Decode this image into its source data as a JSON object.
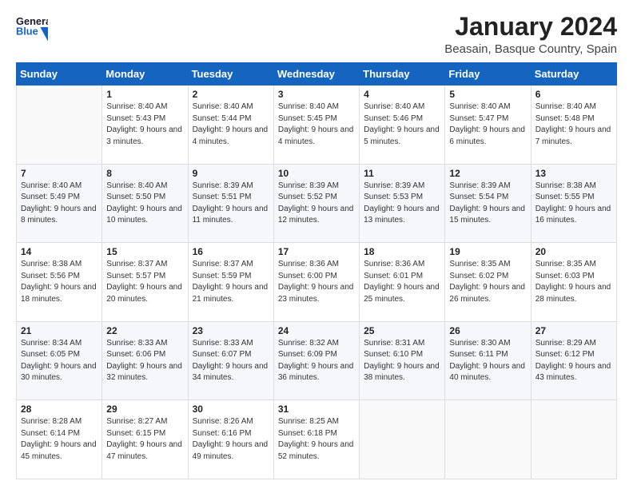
{
  "header": {
    "logo_line1": "General",
    "logo_line2": "Blue",
    "title": "January 2024",
    "subtitle": "Beasain, Basque Country, Spain"
  },
  "days_of_week": [
    "Sunday",
    "Monday",
    "Tuesday",
    "Wednesday",
    "Thursday",
    "Friday",
    "Saturday"
  ],
  "weeks": [
    [
      {
        "day": "",
        "sunrise": "",
        "sunset": "",
        "daylight": ""
      },
      {
        "day": "1",
        "sunrise": "Sunrise: 8:40 AM",
        "sunset": "Sunset: 5:43 PM",
        "daylight": "Daylight: 9 hours and 3 minutes."
      },
      {
        "day": "2",
        "sunrise": "Sunrise: 8:40 AM",
        "sunset": "Sunset: 5:44 PM",
        "daylight": "Daylight: 9 hours and 4 minutes."
      },
      {
        "day": "3",
        "sunrise": "Sunrise: 8:40 AM",
        "sunset": "Sunset: 5:45 PM",
        "daylight": "Daylight: 9 hours and 4 minutes."
      },
      {
        "day": "4",
        "sunrise": "Sunrise: 8:40 AM",
        "sunset": "Sunset: 5:46 PM",
        "daylight": "Daylight: 9 hours and 5 minutes."
      },
      {
        "day": "5",
        "sunrise": "Sunrise: 8:40 AM",
        "sunset": "Sunset: 5:47 PM",
        "daylight": "Daylight: 9 hours and 6 minutes."
      },
      {
        "day": "6",
        "sunrise": "Sunrise: 8:40 AM",
        "sunset": "Sunset: 5:48 PM",
        "daylight": "Daylight: 9 hours and 7 minutes."
      }
    ],
    [
      {
        "day": "7",
        "sunrise": "Sunrise: 8:40 AM",
        "sunset": "Sunset: 5:49 PM",
        "daylight": "Daylight: 9 hours and 8 minutes."
      },
      {
        "day": "8",
        "sunrise": "Sunrise: 8:40 AM",
        "sunset": "Sunset: 5:50 PM",
        "daylight": "Daylight: 9 hours and 10 minutes."
      },
      {
        "day": "9",
        "sunrise": "Sunrise: 8:39 AM",
        "sunset": "Sunset: 5:51 PM",
        "daylight": "Daylight: 9 hours and 11 minutes."
      },
      {
        "day": "10",
        "sunrise": "Sunrise: 8:39 AM",
        "sunset": "Sunset: 5:52 PM",
        "daylight": "Daylight: 9 hours and 12 minutes."
      },
      {
        "day": "11",
        "sunrise": "Sunrise: 8:39 AM",
        "sunset": "Sunset: 5:53 PM",
        "daylight": "Daylight: 9 hours and 13 minutes."
      },
      {
        "day": "12",
        "sunrise": "Sunrise: 8:39 AM",
        "sunset": "Sunset: 5:54 PM",
        "daylight": "Daylight: 9 hours and 15 minutes."
      },
      {
        "day": "13",
        "sunrise": "Sunrise: 8:38 AM",
        "sunset": "Sunset: 5:55 PM",
        "daylight": "Daylight: 9 hours and 16 minutes."
      }
    ],
    [
      {
        "day": "14",
        "sunrise": "Sunrise: 8:38 AM",
        "sunset": "Sunset: 5:56 PM",
        "daylight": "Daylight: 9 hours and 18 minutes."
      },
      {
        "day": "15",
        "sunrise": "Sunrise: 8:37 AM",
        "sunset": "Sunset: 5:57 PM",
        "daylight": "Daylight: 9 hours and 20 minutes."
      },
      {
        "day": "16",
        "sunrise": "Sunrise: 8:37 AM",
        "sunset": "Sunset: 5:59 PM",
        "daylight": "Daylight: 9 hours and 21 minutes."
      },
      {
        "day": "17",
        "sunrise": "Sunrise: 8:36 AM",
        "sunset": "Sunset: 6:00 PM",
        "daylight": "Daylight: 9 hours and 23 minutes."
      },
      {
        "day": "18",
        "sunrise": "Sunrise: 8:36 AM",
        "sunset": "Sunset: 6:01 PM",
        "daylight": "Daylight: 9 hours and 25 minutes."
      },
      {
        "day": "19",
        "sunrise": "Sunrise: 8:35 AM",
        "sunset": "Sunset: 6:02 PM",
        "daylight": "Daylight: 9 hours and 26 minutes."
      },
      {
        "day": "20",
        "sunrise": "Sunrise: 8:35 AM",
        "sunset": "Sunset: 6:03 PM",
        "daylight": "Daylight: 9 hours and 28 minutes."
      }
    ],
    [
      {
        "day": "21",
        "sunrise": "Sunrise: 8:34 AM",
        "sunset": "Sunset: 6:05 PM",
        "daylight": "Daylight: 9 hours and 30 minutes."
      },
      {
        "day": "22",
        "sunrise": "Sunrise: 8:33 AM",
        "sunset": "Sunset: 6:06 PM",
        "daylight": "Daylight: 9 hours and 32 minutes."
      },
      {
        "day": "23",
        "sunrise": "Sunrise: 8:33 AM",
        "sunset": "Sunset: 6:07 PM",
        "daylight": "Daylight: 9 hours and 34 minutes."
      },
      {
        "day": "24",
        "sunrise": "Sunrise: 8:32 AM",
        "sunset": "Sunset: 6:09 PM",
        "daylight": "Daylight: 9 hours and 36 minutes."
      },
      {
        "day": "25",
        "sunrise": "Sunrise: 8:31 AM",
        "sunset": "Sunset: 6:10 PM",
        "daylight": "Daylight: 9 hours and 38 minutes."
      },
      {
        "day": "26",
        "sunrise": "Sunrise: 8:30 AM",
        "sunset": "Sunset: 6:11 PM",
        "daylight": "Daylight: 9 hours and 40 minutes."
      },
      {
        "day": "27",
        "sunrise": "Sunrise: 8:29 AM",
        "sunset": "Sunset: 6:12 PM",
        "daylight": "Daylight: 9 hours and 43 minutes."
      }
    ],
    [
      {
        "day": "28",
        "sunrise": "Sunrise: 8:28 AM",
        "sunset": "Sunset: 6:14 PM",
        "daylight": "Daylight: 9 hours and 45 minutes."
      },
      {
        "day": "29",
        "sunrise": "Sunrise: 8:27 AM",
        "sunset": "Sunset: 6:15 PM",
        "daylight": "Daylight: 9 hours and 47 minutes."
      },
      {
        "day": "30",
        "sunrise": "Sunrise: 8:26 AM",
        "sunset": "Sunset: 6:16 PM",
        "daylight": "Daylight: 9 hours and 49 minutes."
      },
      {
        "day": "31",
        "sunrise": "Sunrise: 8:25 AM",
        "sunset": "Sunset: 6:18 PM",
        "daylight": "Daylight: 9 hours and 52 minutes."
      },
      {
        "day": "",
        "sunrise": "",
        "sunset": "",
        "daylight": ""
      },
      {
        "day": "",
        "sunrise": "",
        "sunset": "",
        "daylight": ""
      },
      {
        "day": "",
        "sunrise": "",
        "sunset": "",
        "daylight": ""
      }
    ]
  ]
}
